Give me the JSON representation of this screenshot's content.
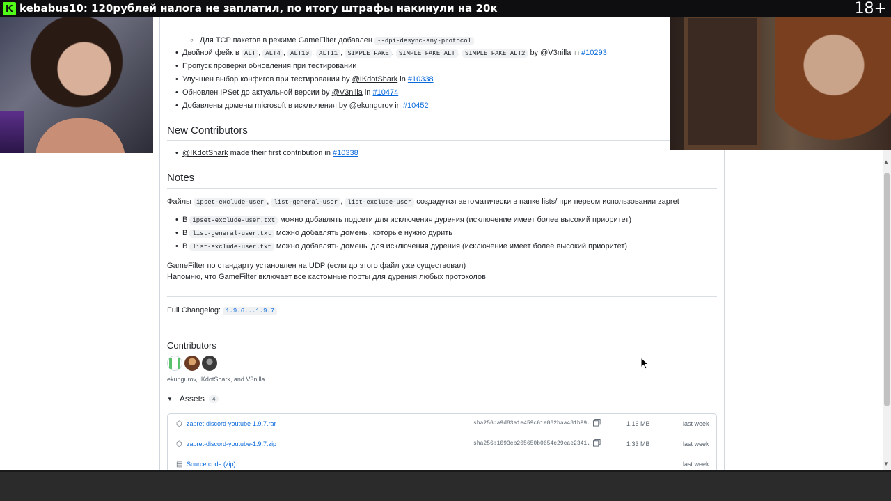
{
  "stream_overlay": {
    "logo_letter": "K",
    "donation_text": "kebabus10: 120рублей налога не заплатил, по итогу штрафы накинули на 20к",
    "age_rating": "18+"
  },
  "release": {
    "sub_item": {
      "text": "Для TCP пакетов в режиме GameFilter добавлен",
      "code": "--dpi-desync-any-protocol"
    },
    "changes": [
      {
        "text": "Двойной фейк в",
        "codes": [
          "ALT",
          "ALT4",
          "ALT10",
          "ALT11",
          "SIMPLE FAKE",
          "SIMPLE FAKE ALT",
          "SIMPLE FAKE ALT2"
        ],
        "by": "by",
        "user": "@V3nilla",
        "in": "in",
        "pr": "#10293"
      },
      {
        "text": "Пропуск проверки обновления при тестировании"
      },
      {
        "text": "Улучшен выбор конфигов при тестировании by",
        "user": "@IKdotShark",
        "in": "in",
        "pr": "#10338"
      },
      {
        "text": "Обновлен IPSet до актуальной версии by",
        "user": "@V3nilla",
        "in": "in",
        "pr": "#10474"
      },
      {
        "text": "Добавлены домены microsoft в исключения by",
        "user": "@ekungurov",
        "in": "in",
        "pr": "#10452"
      }
    ],
    "new_contributors_title": "New Contributors",
    "new_contributor": {
      "user": "@IKdotShark",
      "text": "made their first contribution in",
      "pr": "#10338"
    },
    "notes_title": "Notes",
    "notes_intro": {
      "prefix": "Файлы",
      "codes": [
        "ipset-exclude-user",
        "list-general-user",
        "list-exclude-user"
      ],
      "suffix": "создадутся автоматически в папке lists/ при первом использовании zapret"
    },
    "notes_items": [
      {
        "prefix": "В",
        "code": "ipset-exclude-user.txt",
        "text": "можно добавлять подсети для исключения дурения (исключение имеет более высокий приоритет)"
      },
      {
        "prefix": "В",
        "code": "list-general-user.txt",
        "text": "можно добавлять домены, которые нужно дурить"
      },
      {
        "prefix": "В",
        "code": "list-exclude-user.txt",
        "text": "можно добавлять домены для исключения дурения (исключение имеет более высокий приоритет)"
      }
    ],
    "gamefilter_line1": "GameFilter по стандарту установлен на UDP (если до этого файл уже существовал)",
    "gamefilter_line2": "Напомню, что GameFilter включает все кастомные порты для дурения любых протоколов",
    "changelog_label": "Full Changelog:",
    "changelog_link": "1.9.6...1.9.7"
  },
  "contributors": {
    "title": "Contributors",
    "names": "ekungurov, IKdotShark, and V3nilla"
  },
  "assets": {
    "title": "Assets",
    "count": "4",
    "items": [
      {
        "name": "zapret-discord-youtube-1.9.7.rar",
        "sha": "sha256:a9d83a1e459c61e862baa481b99...",
        "size": "1.16 MB",
        "date": "last week",
        "icon": "package-icon"
      },
      {
        "name": "zapret-discord-youtube-1.9.7.zip",
        "sha": "sha256:1093cb205650b0654c29cae2341...",
        "size": "1.33 MB",
        "date": "last week",
        "icon": "package-icon"
      },
      {
        "name": "Source code (zip)",
        "sha": "",
        "size": "",
        "date": "last week",
        "icon": "file-zip-icon"
      }
    ]
  },
  "colors": {
    "link": "#0969da",
    "kick_green": "#53fc18",
    "border": "#d0d7de"
  }
}
